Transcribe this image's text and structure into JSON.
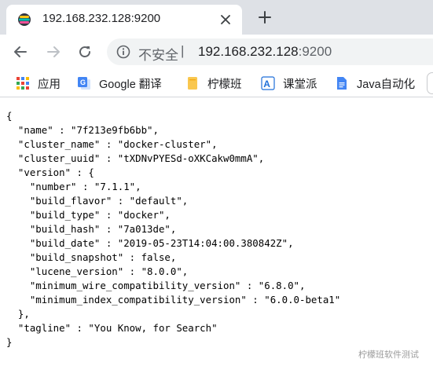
{
  "browser": {
    "tab": {
      "title": "192.168.232.128:9200",
      "favicon": "elastic-favicon-icon",
      "close_icon": "close-icon"
    },
    "new_tab_icon": "plus-icon",
    "toolbar": {
      "back_icon": "back-arrow-icon",
      "forward_icon": "forward-arrow-icon",
      "reload_icon": "reload-icon",
      "security_icon": "info-icon",
      "security_label": "不安全",
      "separator": "|",
      "url_host": "192.168.232.128",
      "url_port": ":9200"
    },
    "bookmarks": [
      {
        "label": "应用",
        "icon": "apps-grid-icon"
      },
      {
        "label": "Google 翻译",
        "icon": "google-translate-icon"
      },
      {
        "label": "柠檬班",
        "icon": "folder-icon"
      },
      {
        "label": "课堂派",
        "icon": "ketangpai-icon"
      },
      {
        "label": "Java自动化",
        "icon": "doc-icon"
      }
    ]
  },
  "response": {
    "text": "{\n  \"name\" : \"7f213e9fb6bb\",\n  \"cluster_name\" : \"docker-cluster\",\n  \"cluster_uuid\" : \"tXDNvPYESd-oXKCakw0mmA\",\n  \"version\" : {\n    \"number\" : \"7.1.1\",\n    \"build_flavor\" : \"default\",\n    \"build_type\" : \"docker\",\n    \"build_hash\" : \"7a013de\",\n    \"build_date\" : \"2019-05-23T14:04:00.380842Z\",\n    \"build_snapshot\" : false,\n    \"lucene_version\" : \"8.0.0\",\n    \"minimum_wire_compatibility_version\" : \"6.8.0\",\n    \"minimum_index_compatibility_version\" : \"6.0.0-beta1\"\n  },\n  \"tagline\" : \"You Know, for Search\"\n}"
  },
  "watermark": "柠檬班软件测试",
  "colors": {
    "tabstrip": "#dee1e6",
    "omnibox": "#f1f3f4",
    "text": "#202124",
    "muted": "#5f6368"
  }
}
